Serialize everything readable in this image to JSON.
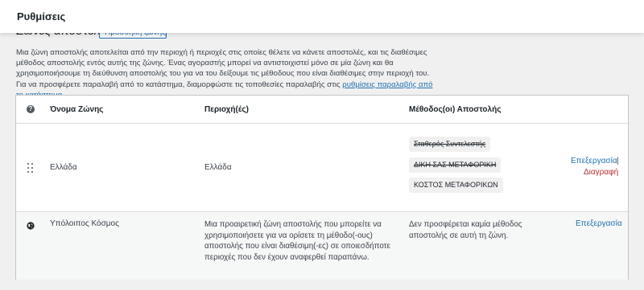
{
  "topbar": {
    "title": "Ρυθμίσεις"
  },
  "section": {
    "heading": "Ζώνες αποστολής",
    "add_button": "Προσθήκη ζώνης"
  },
  "intro": {
    "text": "Μια ζώνη αποστολής αποτελείται από την περιοχή ή περιοχές στις οποίες θέλετε να κάνετε αποστολές, και τις διαθέσιμες μέθοδος αποστολής εντός αυτής της ζώνης. Ένας αγοραστής μπορεί να αντιστοιχιστεί μόνο σε μία ζώνη και θα χρησιμοποιήσουμε τη διεύθυνση αποστολής του για να του δείξουμε τις μέθοδους που είναι διαθέσιμες στην περιοχή του. Για να προσφέρετε παραλαβή από το κατάστημα, διαμορφώστε τις τοποθεσίες παραλαβής στις ",
    "link": "ρυθμίσεις παραλαβής από το κατάστημα",
    "suffix": "."
  },
  "table": {
    "headers": {
      "name": "Όνομα Ζώνης",
      "regions": "Περιοχή(ές)",
      "methods": "Μέθοδος(οι) Αποστολής"
    },
    "rows": [
      {
        "name": "Ελλάδα",
        "region": "Ελλάδα",
        "methods": [
          {
            "label": "Σταθερός Συντελεστής",
            "disabled": true
          },
          {
            "label": "ΔΙΚΗ ΣΑΣ ΜΕΤΑΦΟΡΙΚΗ",
            "disabled": true
          },
          {
            "label": "ΚΟΣΤΟΣ ΜΕΤΑΦΟΡΙΚΩΝ",
            "disabled": false
          }
        ],
        "edit": "Επεξεργασία",
        "separator": "|",
        "delete": "Διαγραφή"
      },
      {
        "name": "Υπόλοιπος Κόσμος",
        "region": "Μια προαιρετική ζώνη αποστολής που μπορείτε να χρησιμοποιήσετε για να ορίσετε τη μέθοδο(-ους) αποστολής που είναι διαθέσιμη(-ες) σε οποιεσδήποτε περιοχές που δεν έχουν αναφερθεί παραπάνω.",
        "methods_text": "Δεν προσφέρεται καμία μέθοδος αποστολής σε αυτή τη ζώνη.",
        "edit": "Επεξεργασία"
      }
    ]
  },
  "colors": {
    "link": "#2271b1",
    "delete": "#b32d2e",
    "text": "#3c434a",
    "background": "#f0f0f1"
  },
  "icons": [
    "help-icon",
    "drag-handle-icon",
    "globe-icon"
  ]
}
